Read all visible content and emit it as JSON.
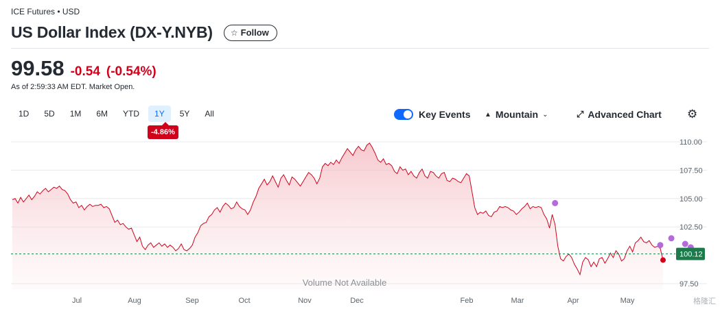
{
  "header": {
    "exchange": "ICE Futures • USD",
    "title": "US Dollar Index (DX-Y.NYB)",
    "follow_label": "Follow",
    "price": "99.58",
    "change": "-0.54",
    "change_pct": "(-0.54%)",
    "as_of": "As of 2:59:33 AM EDT. Market Open."
  },
  "ranges": [
    "1D",
    "5D",
    "1M",
    "6M",
    "YTD",
    "1Y",
    "5Y",
    "All"
  ],
  "active_range": "1Y",
  "range_change": "-4.86%",
  "toolbar": {
    "key_events": "Key Events",
    "chart_type": "Mountain",
    "advanced_chart": "Advanced Chart"
  },
  "colors": {
    "down": "#d0021b",
    "accent": "#0f69ff",
    "event": "#b36bdc",
    "current_price_tag": "#1d7a4b"
  },
  "icons": {
    "follow": "star-icon",
    "chart_type": "mountain-icon",
    "advanced_chart": "expand-arrows-icon",
    "settings": "gear-icon"
  },
  "watermark": "格隆汇",
  "chart_data": {
    "type": "area",
    "title": "",
    "xlabel": "",
    "ylabel": "",
    "ylim": [
      97.5,
      110
    ],
    "yticks": [
      "110.00",
      "107.50",
      "105.00",
      "102.50",
      "97.50"
    ],
    "xticks": [
      "Jul",
      "Aug",
      "Sep",
      "Oct",
      "Nov",
      "Dec",
      "Feb",
      "Mar",
      "Apr",
      "May"
    ],
    "previous_close": 100.12,
    "previous_close_label": "100.12",
    "volume_note": "Volume Not Available",
    "series": [
      {
        "values": [
          104.9,
          105.0,
          104.6,
          105.1,
          104.7,
          105.0,
          105.3,
          104.9,
          105.2,
          105.6,
          105.4,
          105.7,
          105.9,
          105.6,
          105.8,
          106.0,
          105.9,
          106.1,
          105.8,
          105.7,
          105.4,
          104.9,
          104.6,
          104.7,
          104.2,
          104.4,
          104.0,
          104.3,
          104.5,
          104.3,
          104.4,
          104.4,
          104.5,
          104.2,
          104.3,
          104.1,
          103.5,
          102.9,
          103.1,
          102.7,
          102.8,
          102.5,
          102.3,
          102.4,
          101.8,
          101.2,
          101.6,
          100.8,
          100.5,
          100.9,
          101.1,
          100.7,
          100.9,
          101.1,
          100.8,
          101.0,
          100.7,
          100.9,
          100.7,
          100.4,
          100.6,
          101.0,
          100.5,
          100.4,
          100.6,
          100.9,
          101.6,
          102.0,
          102.6,
          102.8,
          102.9,
          103.4,
          103.6,
          104.0,
          104.2,
          103.8,
          104.3,
          104.6,
          104.4,
          104.1,
          104.2,
          104.7,
          104.3,
          104.1,
          104.0,
          103.6,
          104.0,
          104.7,
          105.2,
          105.9,
          106.3,
          106.7,
          106.2,
          106.5,
          107.0,
          106.5,
          106.0,
          106.8,
          107.1,
          106.6,
          106.2,
          106.9,
          106.7,
          106.4,
          106.1,
          106.5,
          106.9,
          107.3,
          107.1,
          106.8,
          106.3,
          106.8,
          107.8,
          108.1,
          107.9,
          108.2,
          108.0,
          108.4,
          108.1,
          108.6,
          109.0,
          109.4,
          109.1,
          108.8,
          109.3,
          109.6,
          109.3,
          109.2,
          109.7,
          109.9,
          109.5,
          109.0,
          108.4,
          108.2,
          108.5,
          108.0,
          108.1,
          107.9,
          107.4,
          107.2,
          107.8,
          107.5,
          107.6,
          107.1,
          107.4,
          107.0,
          106.8,
          107.3,
          107.6,
          107.0,
          106.8,
          107.4,
          107.3,
          107.0,
          106.8,
          107.2,
          107.3,
          106.6,
          106.5,
          106.8,
          106.7,
          106.5,
          106.4,
          106.8,
          107.2,
          107.0,
          105.6,
          104.2,
          103.6,
          103.8,
          103.7,
          103.9,
          103.5,
          103.4,
          103.8,
          103.9,
          104.3,
          104.2,
          104.3,
          104.2,
          104.0,
          103.9,
          103.6,
          103.8,
          104.1,
          104.3,
          104.6,
          104.1,
          104.3,
          104.2,
          104.3,
          104.2,
          103.6,
          103.2,
          102.4,
          103.6,
          102.7,
          100.8,
          99.7,
          99.5,
          99.9,
          100.1,
          99.8,
          99.2,
          98.8,
          98.3,
          99.4,
          99.8,
          99.6,
          99.0,
          99.4,
          99.0,
          99.7,
          99.8,
          99.3,
          99.7,
          100.2,
          99.8,
          100.4,
          100.1,
          99.5,
          99.7,
          100.4,
          100.8,
          100.3,
          101.1,
          101.3,
          101.6,
          101.2,
          101.1,
          101.3,
          100.9,
          100.7,
          100.8,
          100.6,
          99.58
        ]
      }
    ],
    "events": [
      {
        "index": 196,
        "value": 104.6
      },
      {
        "index": 234,
        "value": 100.9
      },
      {
        "index": 238,
        "value": 101.5
      },
      {
        "index": 243,
        "value": 101.0
      },
      {
        "index": 245,
        "value": 100.7
      }
    ]
  }
}
